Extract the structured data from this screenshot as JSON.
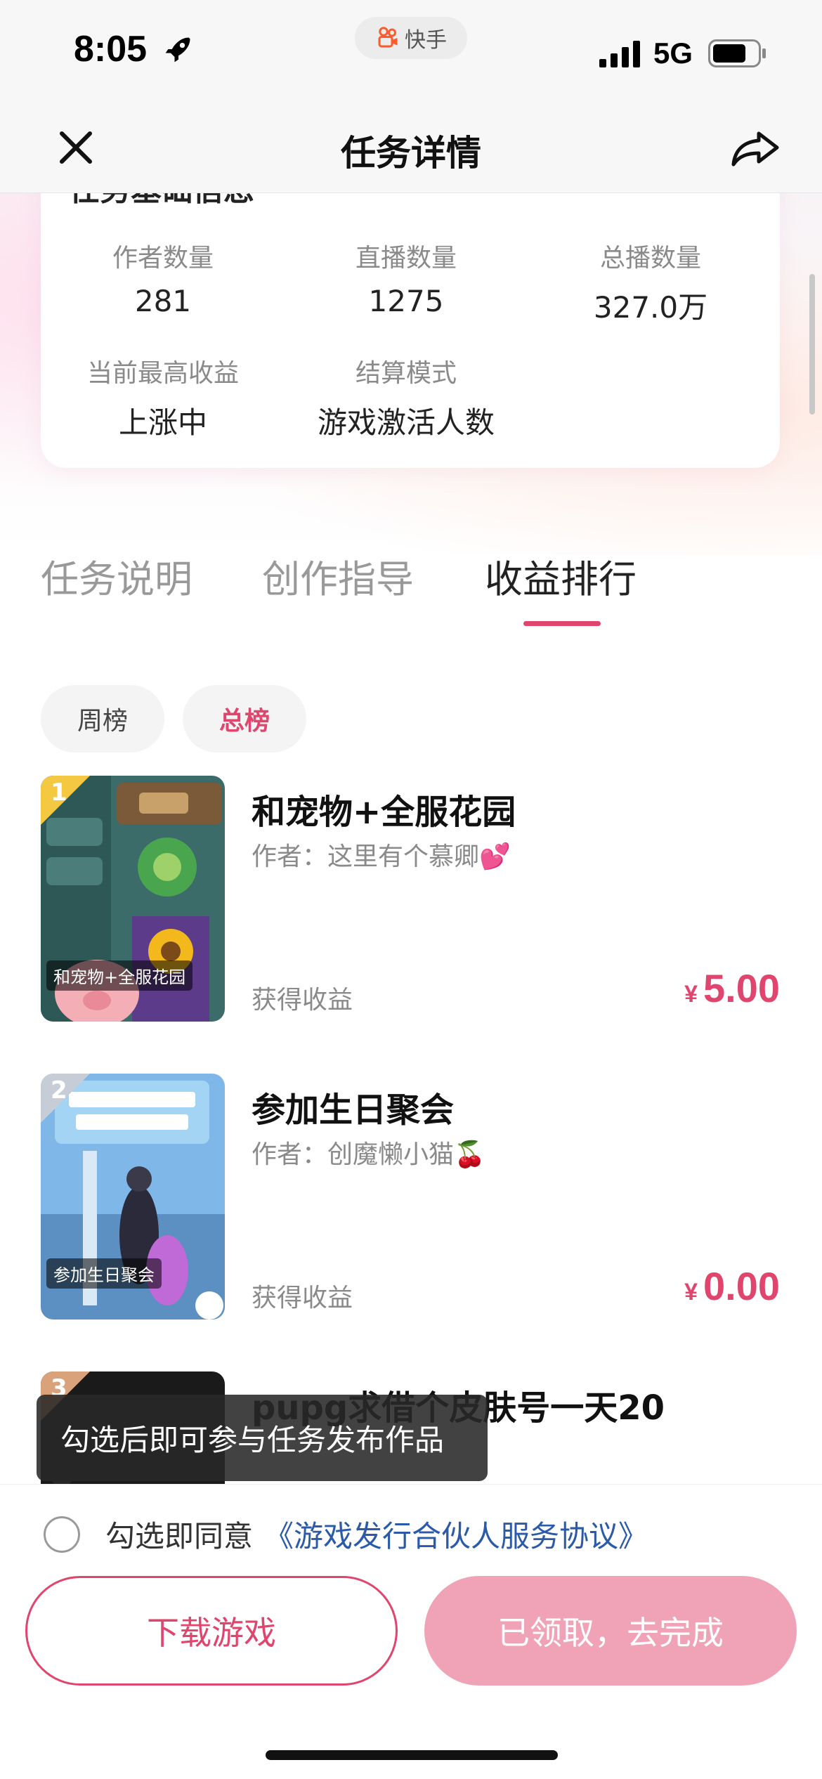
{
  "status_bar": {
    "time": "8:05",
    "app_name": "快手",
    "network": "5G"
  },
  "nav": {
    "title": "任务详情",
    "close_icon": "close-icon",
    "share_icon": "share-icon"
  },
  "info_card": {
    "heading": "任务基础信息",
    "stats": [
      {
        "label": "作者数量",
        "value": "281"
      },
      {
        "label": "直播数量",
        "value": "1275"
      },
      {
        "label": "总播数量",
        "value": "327.0万"
      },
      {
        "label": "当前最高收益",
        "value": "上涨中"
      },
      {
        "label": "结算模式",
        "value": "游戏激活人数"
      }
    ]
  },
  "tabs": [
    {
      "label": "任务说明",
      "active": false
    },
    {
      "label": "创作指导",
      "active": false
    },
    {
      "label": "收益排行",
      "active": true
    }
  ],
  "subtabs": {
    "weekly": "周榜",
    "total": "总榜",
    "selected": "总榜"
  },
  "ranking": [
    {
      "rank": "1",
      "title": "和宠物+全服花园",
      "author": "作者：这里有个慕卿💕",
      "thumb_caption": "和宠物+全服花园",
      "earn_label": "获得收益",
      "currency": "¥",
      "amount": "5.00"
    },
    {
      "rank": "2",
      "title": "参加生日聚会",
      "author": "作者：创魔懒小猫🍒",
      "thumb_caption": "参加生日聚会",
      "earn_label": "获得收益",
      "currency": "¥",
      "amount": "0.00"
    },
    {
      "rank": "3",
      "title": "pupg求借个皮肤号一天20"
    }
  ],
  "tooltip": {
    "text": "勾选后即可参与任务发布作品"
  },
  "bottom": {
    "agree_text": "勾选即同意",
    "agree_link": "《游戏发行合伙人服务协议》",
    "download_button": "下载游戏",
    "claim_button": "已领取，去完成"
  },
  "colors": {
    "accent": "#e0456e",
    "claim_bg": "#f0a3b6",
    "link": "#2b5aa8"
  }
}
